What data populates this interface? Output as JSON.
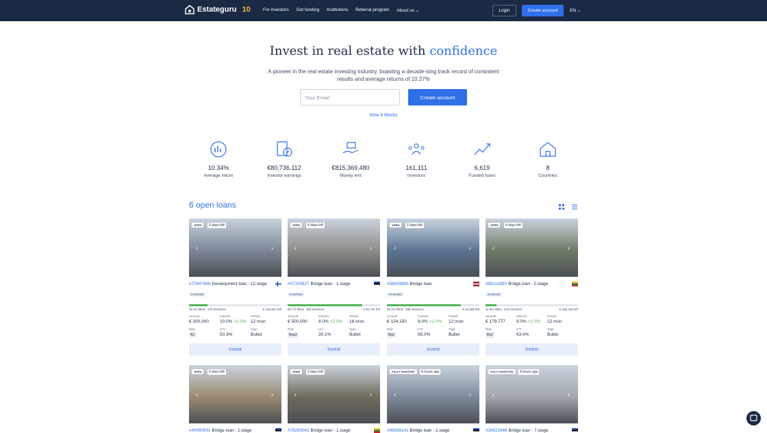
{
  "header": {
    "logo_text": "Estateguru",
    "logo_badge": "10",
    "nav": [
      "For investors",
      "Get funding",
      "Institutions",
      "Referral program",
      "About us"
    ],
    "login_label": "Login",
    "create_account_label": "Create account",
    "language": "EN"
  },
  "hero": {
    "title_main": "Invest in real estate with",
    "title_accent": "confidence",
    "subtitle": "A pioneer in the real estate investing industry, boasting a decade-long track record of consistent results and average returns of 10.37%",
    "email_placeholder": "Your Email",
    "cta_label": "Create account",
    "how_link": "How it Works"
  },
  "stats": [
    {
      "icon": "chart-icon",
      "value": "10.34%",
      "label": "Average return"
    },
    {
      "icon": "earnings-icon",
      "value": "€80,736,112",
      "label": "Investor earnings"
    },
    {
      "icon": "money-icon",
      "value": "€815,369,480",
      "label": "Money lent"
    },
    {
      "icon": "investors-icon",
      "value": "161,111",
      "label": "Investors"
    },
    {
      "icon": "growth-icon",
      "value": "6,619",
      "label": "Funded loans"
    },
    {
      "icon": "house-icon",
      "value": "8",
      "label": "Countries"
    }
  ],
  "loans_section": {
    "title": "6 open loans",
    "cards": [
      {
        "badge": "OPEN",
        "timer": "5 days left",
        "id": "#72947666",
        "name": "Development loan - 12.stage",
        "flag": "fi",
        "bonus": "EG BONUS",
        "filled_pct": 20.3,
        "filled": "20.3% filled,",
        "investors": "279 investors",
        "left": "€ 159,321 left",
        "amount": "€ 200,000",
        "interest": "10.0%",
        "interest_plus": "+2.0%",
        "period": "12 mon",
        "risk": "A3",
        "ltv": "50.3%",
        "type": "Bullet",
        "photo_bg": "#7d8795",
        "invest_label": "Invest"
      },
      {
        "badge": "OPEN",
        "timer": "4 days left",
        "id": "#57105937",
        "name": "Bridge loan - 1.stage",
        "flag": "ee",
        "bonus": "EG BONUS",
        "filled_pct": 80.7,
        "filled": "80.7% filled,",
        "investors": "359 investors",
        "left": "€ 96,701 left",
        "amount": "€ 500,000",
        "interest": "8.0%",
        "interest_plus": "+2.0%",
        "period": "18 mon",
        "risk": "Baa3",
        "ltv": "30.1%",
        "type": "Bullet",
        "photo_bg": "#8e8d87",
        "invest_label": "Invest"
      },
      {
        "badge": "OPEN",
        "timer": "2 days left",
        "id": "#58639890",
        "name": "Bridge loan",
        "flag": "lv",
        "bonus": "EG BONUS",
        "filled_pct": 80.2,
        "filled": "80.2% filled,",
        "investors": "288 investors",
        "left": "€ 24,568 left",
        "amount": "€ 124,150",
        "interest": "9.0%",
        "interest_plus": "+2.0%",
        "period": "12 mon",
        "risk": "Ba2",
        "ltv": "65.0%",
        "type": "Bullet",
        "photo_bg": "#5b7492",
        "invest_label": "Invest"
      },
      {
        "badge": "OPEN",
        "timer": "4 days left",
        "id": "#88113580",
        "name": "Bridge loan - 2.stage",
        "flag": "lt",
        "bonus": "EG BONUS",
        "filled_pct": 11.8,
        "filled": "11.8% filled,",
        "investors": "215 investors",
        "left": "€ 158,493 left",
        "amount": "€ 179,777",
        "interest": "9.0%",
        "interest_plus": "+2.0%",
        "period": "12 mon",
        "risk": "Ba2",
        "ltv": "63.4%",
        "type": "Bullet",
        "photo_bg": "#6e7b65",
        "invest_label": "Invest"
      }
    ],
    "row2": [
      {
        "badge": "OPEN",
        "timer": "6 days left",
        "id": "#40090591",
        "name": "Bridge loan - 1.stage",
        "flag": "ee",
        "photo_bg": "#9a8a72"
      },
      {
        "badge": "OPEN",
        "timer": "2 days left",
        "id": "#78293043",
        "name": "Bridge loan - 1.stage",
        "flag": "lt",
        "photo_bg": "#6f6a5a"
      },
      {
        "badge": "FULLY INVESTED",
        "timer": "4 hours ago",
        "id": "#96638141",
        "name": "Bridge loan - 2.stage",
        "flag": "ee",
        "photo_bg": "#7e8a99"
      },
      {
        "badge": "FULLY INVESTED",
        "timer": "4 hours ago",
        "id": "#26622946",
        "name": "Bridge loan - 7.stage",
        "flag": "ee",
        "photo_bg": "#a3a7ad"
      }
    ],
    "labels": {
      "amount": "Amount",
      "interest": "Interest",
      "period": "Period",
      "risk": "Risk",
      "ltv": "LTV",
      "type": "Type"
    }
  },
  "colors": {
    "navy": "#1b2a44",
    "accent": "#2f6fe8",
    "green": "#54b45c"
  }
}
